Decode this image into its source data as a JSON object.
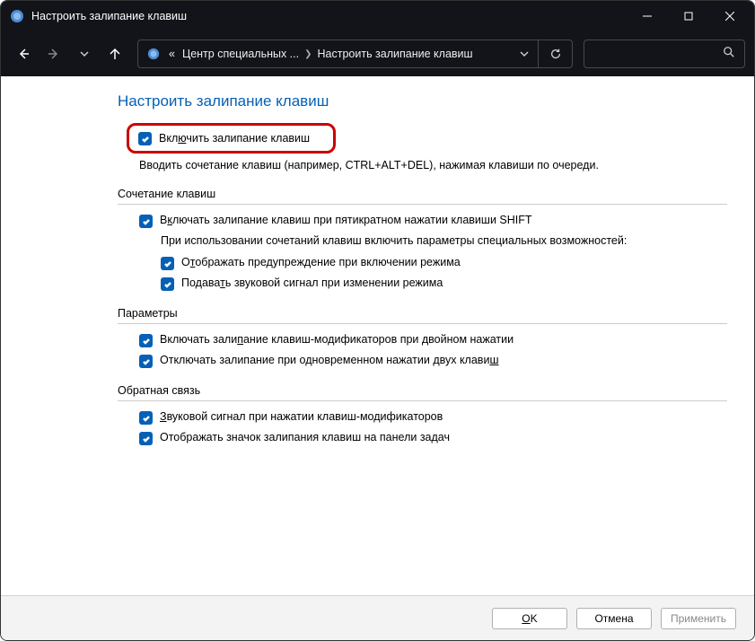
{
  "window": {
    "title": "Настроить залипание клавиш"
  },
  "breadcrumb": {
    "prefix": "«",
    "item1": "Центр специальных ...",
    "item2": "Настроить залипание клавиш"
  },
  "page": {
    "heading": "Настроить залипание клавиш",
    "main_checkbox": "Включить залипание клавиш",
    "main_desc": "Вводить сочетание клавиш (например, CTRL+ALT+DEL), нажимая клавиши по очереди."
  },
  "sections": {
    "combo": {
      "title": "Сочетание клавиш",
      "cb1": "Включать залипание клавиш при пятикратном нажатии клавиши SHIFT",
      "sub": "При использовании сочетаний клавиш включить параметры специальных возможностей:",
      "cb2": "Отображать предупреждение при включении режима",
      "cb3": "Подавать звуковой сигнал при изменении режима"
    },
    "params": {
      "title": "Параметры",
      "cb1": "Включать залипание клавиш-модификаторов при двойном нажатии",
      "cb2": "Отключать залипание при одновременном нажатии двух клавиш"
    },
    "feedback": {
      "title": "Обратная связь",
      "cb1": "Звуковой сигнал при нажатии клавиш-модификаторов",
      "cb2": "Отображать значок залипания клавиш на панели задач"
    }
  },
  "footer": {
    "ok": "OK",
    "cancel": "Отмена",
    "apply": "Применить"
  }
}
